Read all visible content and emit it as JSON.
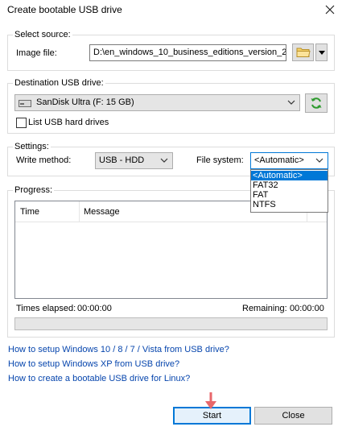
{
  "window": {
    "title": "Create bootable USB drive"
  },
  "source": {
    "legend": "Select source:",
    "image_label": "Image file:",
    "image_value": "D:\\en_windows_10_business_editions_version_20"
  },
  "destination": {
    "legend": "Destination USB drive:",
    "drive_value": "SanDisk Ultra (F:  15 GB)",
    "list_hdd_label": "List USB hard drives"
  },
  "settings": {
    "legend": "Settings:",
    "write_method_label": "Write method:",
    "write_method_value": "USB - HDD",
    "file_system_label": "File system:",
    "file_system_value": "<Automatic>",
    "file_system_options": [
      "<Automatic>",
      "FAT32",
      "FAT",
      "NTFS"
    ]
  },
  "progress": {
    "legend": "Progress:",
    "columns": [
      "Time",
      "Message"
    ],
    "times_elapsed_label": "Times elapsed:",
    "times_elapsed_value": "00:00:00",
    "remaining_label": "Remaining:",
    "remaining_value": "00:00:00",
    "percent": 0
  },
  "links": [
    "How to setup Windows 10 / 8 / 7 / Vista from USB drive?",
    "How to setup Windows XP from USB drive?",
    "How to create a bootable USB drive for Linux?"
  ],
  "buttons": {
    "start": "Start",
    "close": "Close"
  },
  "colors": {
    "link": "#0645ad",
    "selection": "#0078d7",
    "pointer": "#e8676b"
  },
  "icons": [
    "close-icon",
    "folder-icon",
    "dropdown-arrow-icon",
    "usb-drive-icon",
    "refresh-icon",
    "chevron-down-icon",
    "pointer-arrow-icon"
  ]
}
